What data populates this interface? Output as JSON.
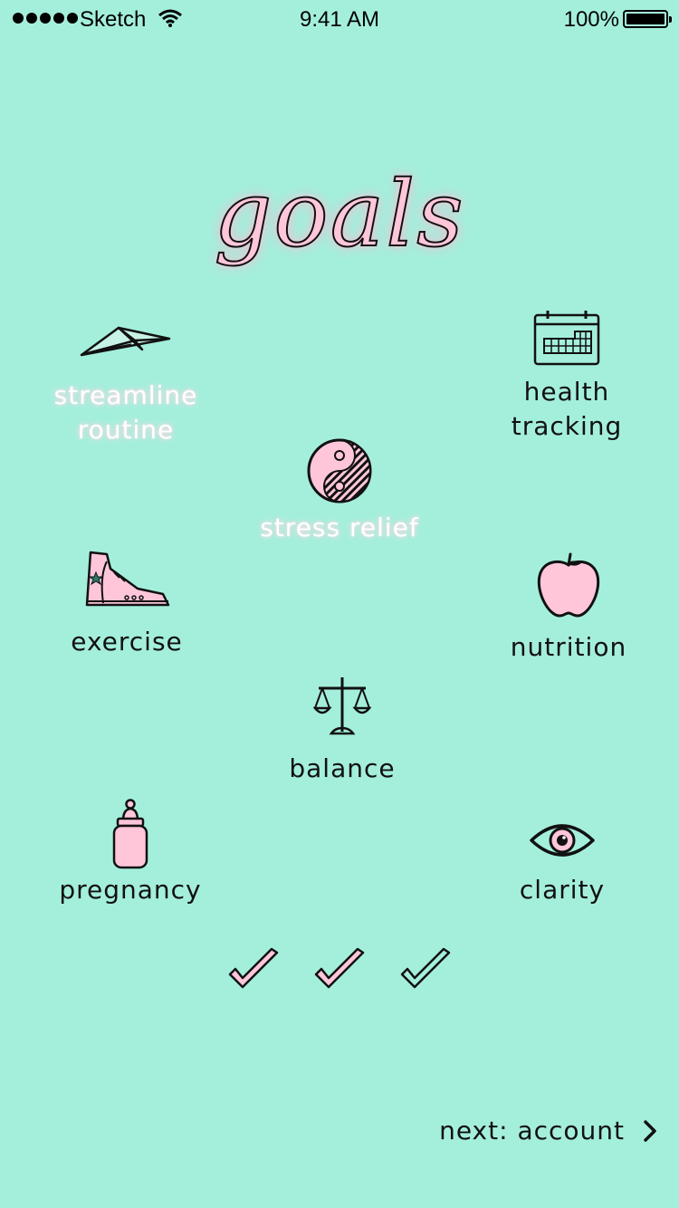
{
  "status_bar": {
    "carrier": "Sketch",
    "time": "9:41 AM",
    "battery": "100%"
  },
  "screen": {
    "title": "goals"
  },
  "goals": {
    "streamline": {
      "label_line1": "streamline",
      "label_line2": "routine",
      "icon": "paper-plane-icon",
      "selected": true
    },
    "health": {
      "label_line1": "health",
      "label_line2": "tracking",
      "icon": "calendar-icon",
      "selected": false
    },
    "stress": {
      "label": "stress relief",
      "icon": "yin-yang-icon",
      "selected": true
    },
    "exercise": {
      "label": "exercise",
      "icon": "sneaker-icon",
      "selected": false
    },
    "nutrition": {
      "label": "nutrition",
      "icon": "apple-icon",
      "selected": false
    },
    "balance": {
      "label": "balance",
      "icon": "scale-icon",
      "selected": false
    },
    "pregnancy": {
      "label": "pregnancy",
      "icon": "baby-bottle-icon",
      "selected": false
    },
    "clarity": {
      "label": "clarity",
      "icon": "eye-icon",
      "selected": false
    }
  },
  "progress": {
    "completed_steps": 3
  },
  "footer": {
    "next_label": "next: account"
  },
  "colors": {
    "background": "#a4efdc",
    "accent_pink": "#ffc6da",
    "ink": "#111111",
    "selected_text": "#ffffff"
  }
}
